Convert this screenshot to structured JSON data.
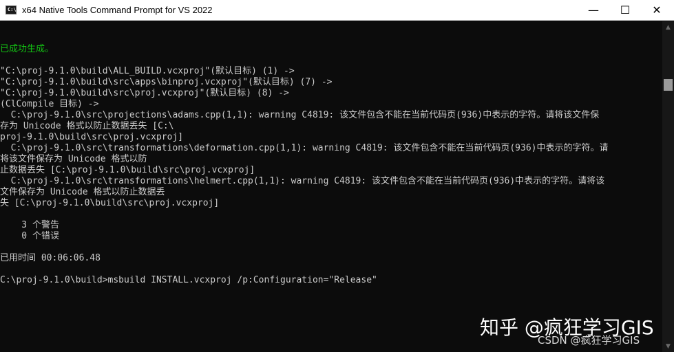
{
  "window": {
    "title": "x64 Native Tools Command Prompt for VS 2022",
    "controls": {
      "minimize": "—",
      "maximize": "☐",
      "close": "✕"
    }
  },
  "console": {
    "success": "已成功生成。",
    "lines": [
      "\"C:\\proj-9.1.0\\build\\ALL_BUILD.vcxproj\"(默认目标) (1) ->",
      "\"C:\\proj-9.1.0\\build\\src\\apps\\binproj.vcxproj\"(默认目标) (7) ->",
      "\"C:\\proj-9.1.0\\build\\src\\proj.vcxproj\"(默认目标) (8) ->",
      "(ClCompile 目标) ->",
      "  C:\\proj-9.1.0\\src\\projections\\adams.cpp(1,1): warning C4819: 该文件包含不能在当前代码页(936)中表示的字符。请将该文件保",
      "存为 Unicode 格式以防止数据丢失 [C:\\",
      "proj-9.1.0\\build\\src\\proj.vcxproj]",
      "  C:\\proj-9.1.0\\src\\transformations\\deformation.cpp(1,1): warning C4819: 该文件包含不能在当前代码页(936)中表示的字符。请",
      "将该文件保存为 Unicode 格式以防",
      "止数据丢失 [C:\\proj-9.1.0\\build\\src\\proj.vcxproj]",
      "  C:\\proj-9.1.0\\src\\transformations\\helmert.cpp(1,1): warning C4819: 该文件包含不能在当前代码页(936)中表示的字符。请将该",
      "文件保存为 Unicode 格式以防止数据丢",
      "失 [C:\\proj-9.1.0\\build\\src\\proj.vcxproj]"
    ],
    "warnings": "    3 个警告",
    "errors": "    0 个错误",
    "elapsed": "已用时间 00:06:06.48",
    "prompt": "C:\\proj-9.1.0\\build>msbuild INSTALL.vcxproj /p:Configuration=\"Release\""
  },
  "watermark": {
    "main": "知乎 @疯狂学习GIS",
    "sub": "CSDN @疯狂学习GIS"
  }
}
